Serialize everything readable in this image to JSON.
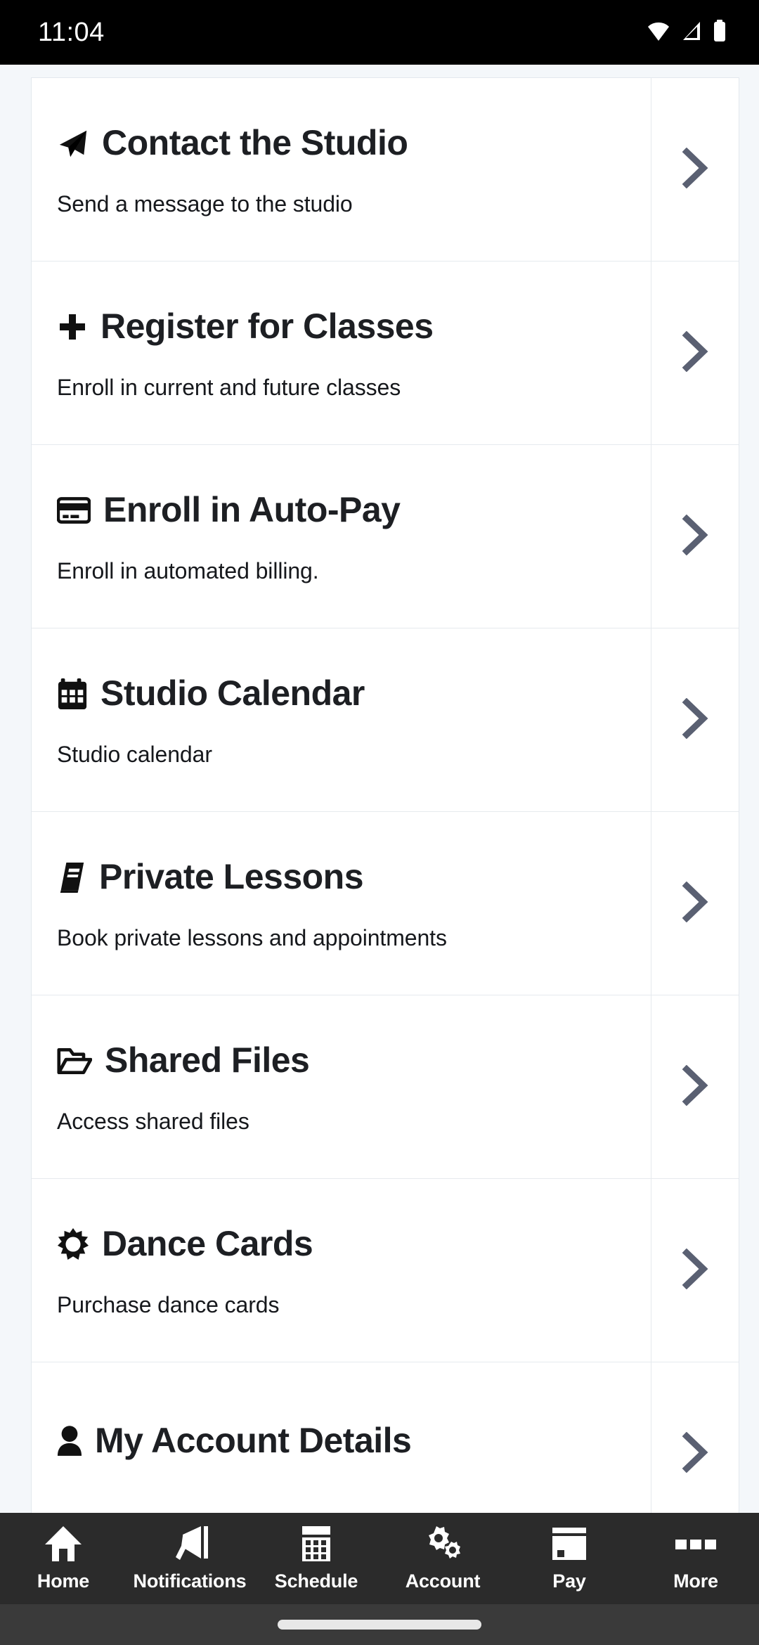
{
  "status_bar": {
    "time": "11:04",
    "icons": [
      "wifi-icon",
      "cellular-signal-icon",
      "battery-icon"
    ]
  },
  "menu": {
    "items": [
      {
        "icon": "paper-plane-icon",
        "title": "Contact the Studio",
        "subtitle": "Send a message to the studio",
        "chevron": "chevron-right-icon"
      },
      {
        "icon": "plus-icon",
        "title": "Register for Classes",
        "subtitle": "Enroll in current and future classes",
        "chevron": "chevron-right-icon"
      },
      {
        "icon": "credit-card-icon",
        "title": "Enroll in Auto-Pay",
        "subtitle": "Enroll in automated billing.",
        "chevron": "chevron-right-icon"
      },
      {
        "icon": "calendar-icon",
        "title": "Studio Calendar",
        "subtitle": "Studio calendar",
        "chevron": "chevron-right-icon"
      },
      {
        "icon": "book-icon",
        "title": "Private Lessons",
        "subtitle": "Book private lessons and appointments",
        "chevron": "chevron-right-icon"
      },
      {
        "icon": "folder-open-icon",
        "title": "Shared Files",
        "subtitle": "Access shared files",
        "chevron": "chevron-right-icon"
      },
      {
        "icon": "sun-burst-icon",
        "title": "Dance Cards",
        "subtitle": "Purchase dance cards",
        "chevron": "chevron-right-icon"
      },
      {
        "icon": "person-icon",
        "title": "My Account Details",
        "subtitle": "",
        "chevron": "chevron-right-icon"
      }
    ]
  },
  "bottom_nav": {
    "items": [
      {
        "icon": "home-icon",
        "label": "Home"
      },
      {
        "icon": "megaphone-icon",
        "label": "Notifications"
      },
      {
        "icon": "calendar-grid-icon",
        "label": "Schedule"
      },
      {
        "icon": "gears-icon",
        "label": "Account"
      },
      {
        "icon": "payment-card-icon",
        "label": "Pay"
      },
      {
        "icon": "ellipsis-icon",
        "label": "More"
      }
    ]
  },
  "colors": {
    "page_background": "#f4f7fa",
    "card_background": "#ffffff",
    "divider": "#e6eaee",
    "title_text": "#1d1f23",
    "chevron": "#5a6072",
    "nav_background": "#2b2b2b",
    "gesture_background": "#3a3a3a",
    "status_background": "#000000"
  }
}
